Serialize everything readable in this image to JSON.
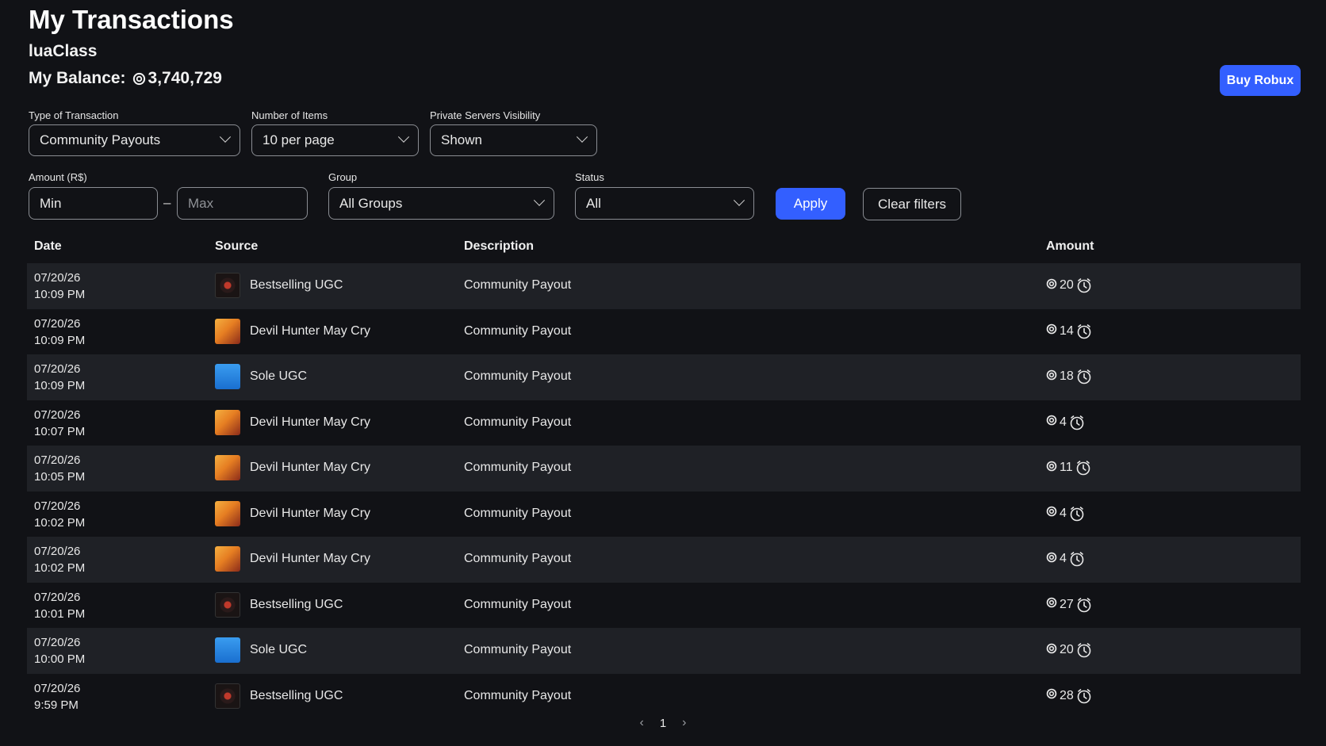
{
  "header": {
    "title": "My Transactions",
    "username": "luaClass",
    "balance_label": "My Balance:",
    "balance_value": "3,740,729",
    "buy_button": "Buy Robux"
  },
  "filters": {
    "type_label": "Type of Transaction",
    "type_value": "Community Payouts",
    "items_label": "Number of Items",
    "items_value": "10 per page",
    "visibility_label": "Private Servers Visibility",
    "visibility_value": "Shown",
    "amount_label": "Amount (R$)",
    "min_value": "Min",
    "max_placeholder": "Max",
    "dash": "–",
    "group_label": "Group",
    "group_value": "All Groups",
    "status_label": "Status",
    "status_value": "All",
    "apply": "Apply",
    "clear": "Clear filters"
  },
  "table": {
    "headers": [
      "Date",
      "Source",
      "Description",
      "Amount"
    ],
    "rows": [
      {
        "date": "07/20/26",
        "time": "10:09 PM",
        "source": "Bestselling UGC",
        "thumb": "bestselling",
        "description": "Community Payout",
        "amount": "20"
      },
      {
        "date": "07/20/26",
        "time": "10:09 PM",
        "source": "Devil Hunter May Cry",
        "thumb": "devil",
        "description": "Community Payout",
        "amount": "14"
      },
      {
        "date": "07/20/26",
        "time": "10:09 PM",
        "source": "Sole UGC",
        "thumb": "sole",
        "description": "Community Payout",
        "amount": "18"
      },
      {
        "date": "07/20/26",
        "time": "10:07 PM",
        "source": "Devil Hunter May Cry",
        "thumb": "devil",
        "description": "Community Payout",
        "amount": "4"
      },
      {
        "date": "07/20/26",
        "time": "10:05 PM",
        "source": "Devil Hunter May Cry",
        "thumb": "devil",
        "description": "Community Payout",
        "amount": "11"
      },
      {
        "date": "07/20/26",
        "time": "10:02 PM",
        "source": "Devil Hunter May Cry",
        "thumb": "devil",
        "description": "Community Payout",
        "amount": "4"
      },
      {
        "date": "07/20/26",
        "time": "10:02 PM",
        "source": "Devil Hunter May Cry",
        "thumb": "devil",
        "description": "Community Payout",
        "amount": "4"
      },
      {
        "date": "07/20/26",
        "time": "10:01 PM",
        "source": "Bestselling UGC",
        "thumb": "bestselling",
        "description": "Community Payout",
        "amount": "27"
      },
      {
        "date": "07/20/26",
        "time": "10:00 PM",
        "source": "Sole UGC",
        "thumb": "sole",
        "description": "Community Payout",
        "amount": "20"
      },
      {
        "date": "07/20/26",
        "time": "9:59 PM",
        "source": "Bestselling UGC",
        "thumb": "bestselling",
        "description": "Community Payout",
        "amount": "28"
      }
    ]
  },
  "pagination": {
    "prev": "‹",
    "page": "1",
    "next": "›"
  },
  "colors": {
    "background": "#111216",
    "row_alt": "#1f2126",
    "accent": "#335fff"
  },
  "icons": {
    "currency": "robux-icon",
    "pending": "clock-icon",
    "dropdown": "chevron-down-icon"
  }
}
